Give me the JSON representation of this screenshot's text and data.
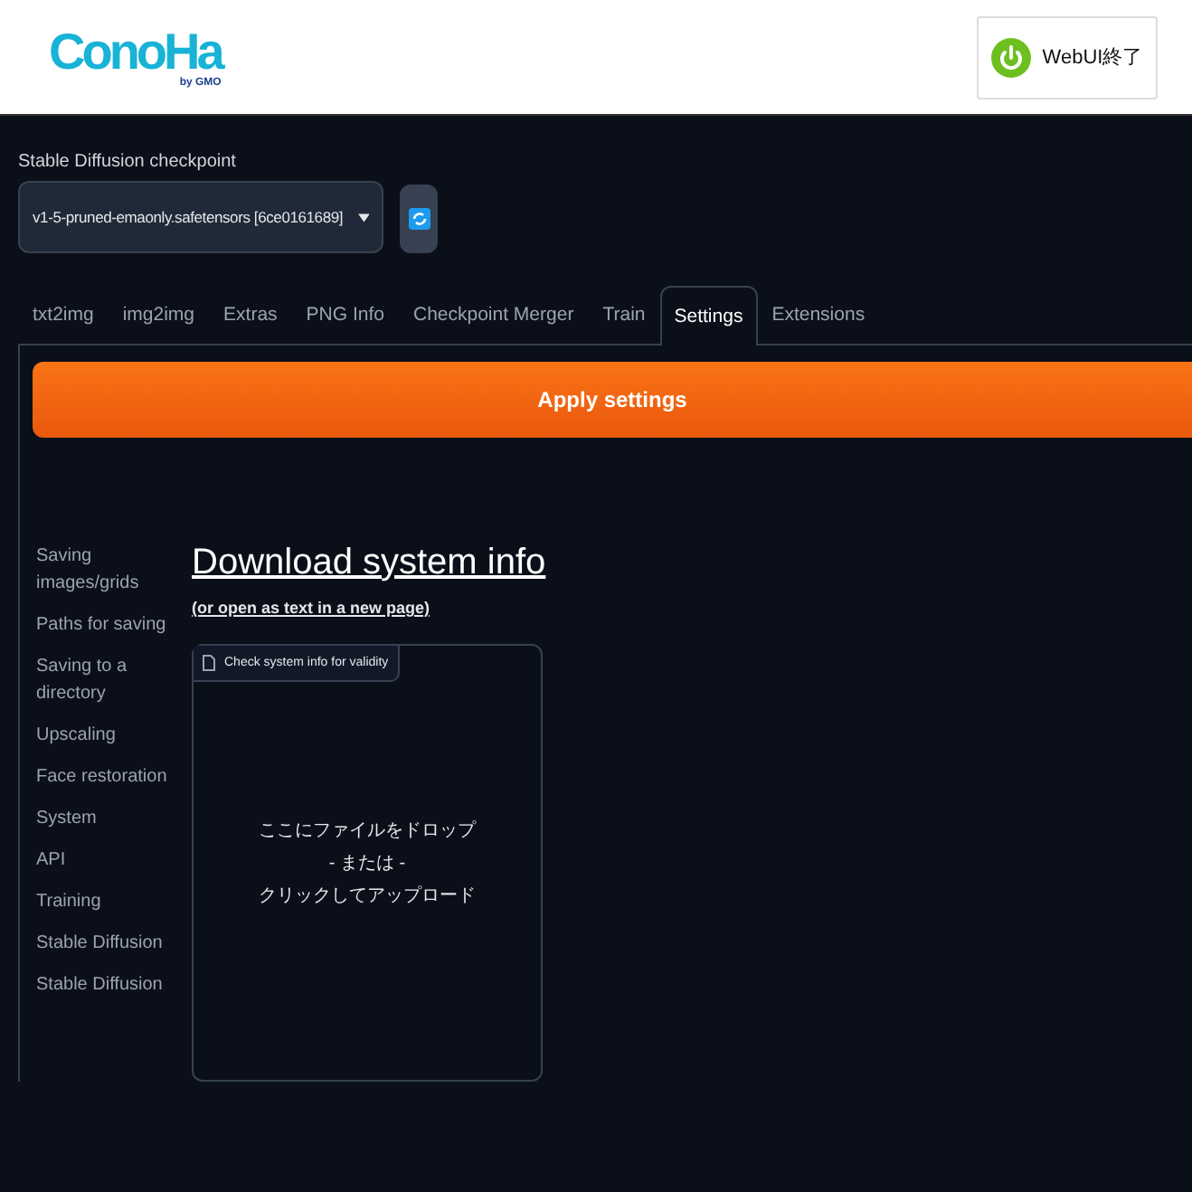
{
  "header": {
    "logo": {
      "wordmark": "ConoHa",
      "byline": "by GMO"
    },
    "quit_button": "WebUI終了"
  },
  "checkpoint": {
    "label": "Stable Diffusion checkpoint",
    "value": "v1-5-pruned-emaonly.safetensors [6ce0161689]"
  },
  "tabs": [
    {
      "label": "txt2img",
      "selected": false
    },
    {
      "label": "img2img",
      "selected": false
    },
    {
      "label": "Extras",
      "selected": false
    },
    {
      "label": "PNG Info",
      "selected": false
    },
    {
      "label": "Checkpoint Merger",
      "selected": false
    },
    {
      "label": "Train",
      "selected": false
    },
    {
      "label": "Settings",
      "selected": true
    },
    {
      "label": "Extensions",
      "selected": false
    }
  ],
  "apply_button": "Apply settings",
  "sidebar": {
    "items": [
      "Saving images/grids",
      "Paths for saving",
      "Saving to a directory",
      "Upscaling",
      "Face restoration",
      "System",
      "API",
      "Training",
      "Stable Diffusion",
      "Stable Diffusion"
    ]
  },
  "main": {
    "heading": "Download system info",
    "link": "(or open as text in a new page)",
    "upload": {
      "label": "Check system info for validity",
      "lines": [
        "ここにファイルをドロップ",
        "- または -",
        "クリックしてアップロード"
      ]
    }
  }
}
